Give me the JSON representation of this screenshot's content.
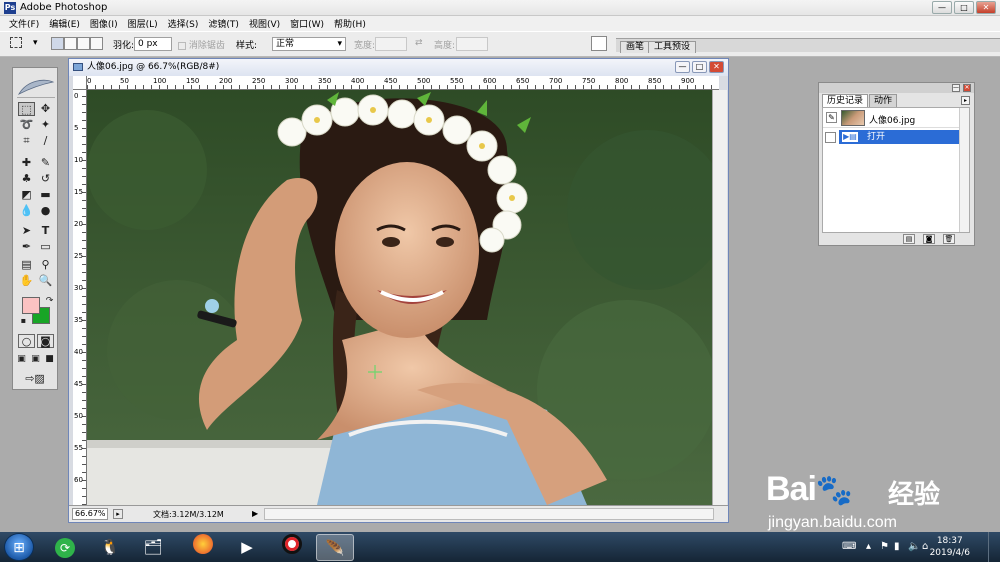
{
  "app": {
    "title": "Adobe Photoshop",
    "icon": "ps-icon"
  },
  "window_controls": {
    "minimize": "—",
    "maximize": "□",
    "close": "✕"
  },
  "menu": [
    "文件(F)",
    "编辑(E)",
    "图像(I)",
    "图层(L)",
    "选择(S)",
    "滤镜(T)",
    "视图(V)",
    "窗口(W)",
    "帮助(H)"
  ],
  "options": {
    "feather_label": "羽化:",
    "feather_value": "0 px",
    "antialias_label": "消除锯齿",
    "style_label": "样式:",
    "style_value": "正常",
    "width_label": "宽度:",
    "height_label": "高度:",
    "swap_glyph": "⇄",
    "palette_tabs": [
      "画笔",
      "工具预设"
    ]
  },
  "document": {
    "title": "人像06.jpg @ 66.7%(RGB/8#)",
    "ruler_top": [
      "0",
      "50",
      "100",
      "150",
      "200",
      "250",
      "300",
      "350",
      "400",
      "450",
      "500",
      "550",
      "600",
      "650",
      "700",
      "750",
      "800",
      "850",
      "900"
    ],
    "ruler_left": [
      "0",
      "5",
      "10",
      "15",
      "20",
      "25",
      "30",
      "35",
      "40",
      "45",
      "50",
      "55",
      "60"
    ],
    "zoom": "66.67%",
    "doc_info": "文档:3.12M/3.12M"
  },
  "history_panel": {
    "tabs": [
      "历史记录",
      "动作"
    ],
    "snapshot": "人像06.jpg",
    "states": [
      "打开"
    ]
  },
  "taskbar": {
    "apps": [
      "360-icon",
      "qq-icon",
      "explorer-icon",
      "firefox-icon",
      "media-player-icon",
      "recorder-icon",
      "photoshop-icon"
    ],
    "time": "18:37",
    "date": "2019/4/6"
  },
  "watermark": {
    "brand": "Bai",
    "brand_suffix": "经验",
    "url": "jingyan.baidu.com"
  }
}
